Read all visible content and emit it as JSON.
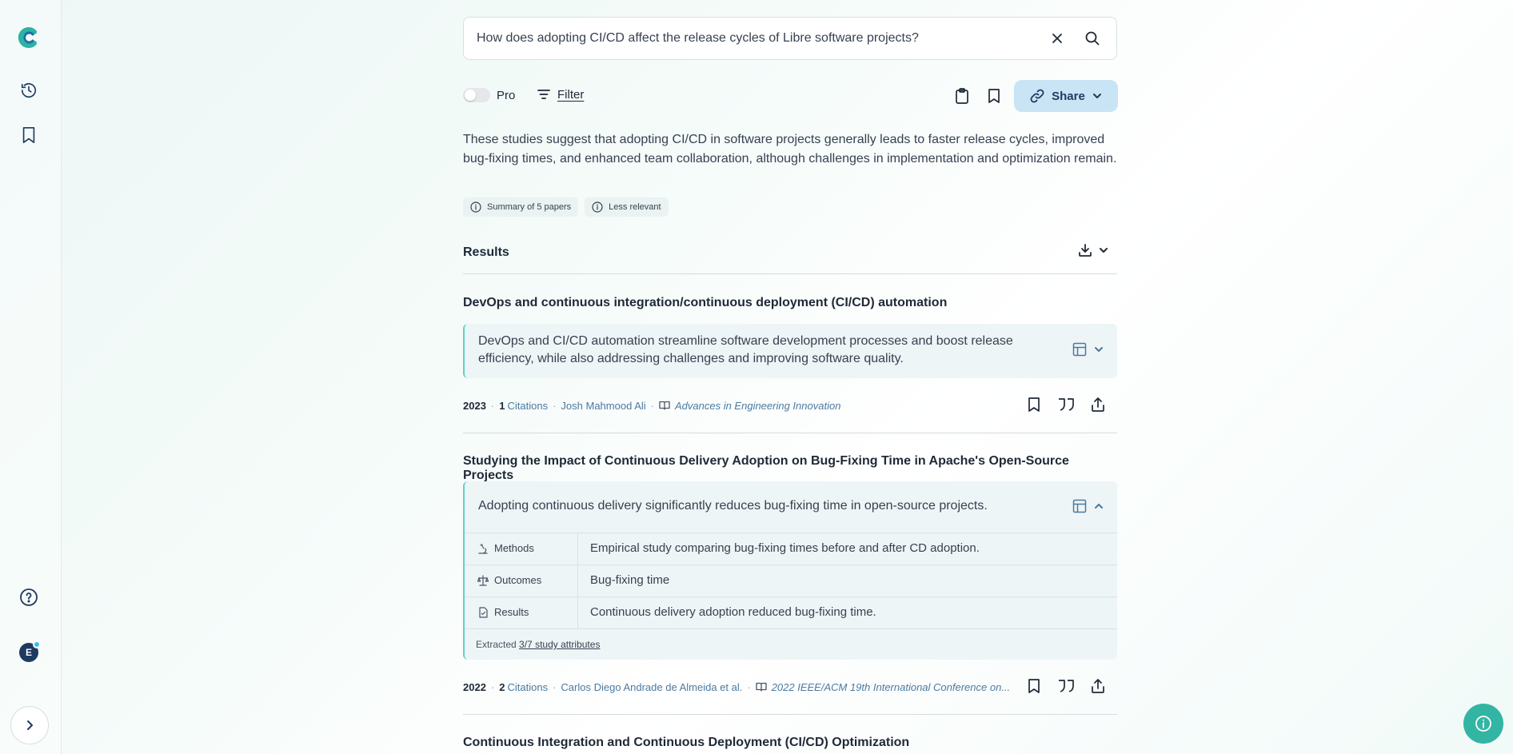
{
  "search": {
    "query": "How does adopting CI/CD affect the release cycles of Libre software projects?"
  },
  "toolbar": {
    "pro_label": "Pro",
    "filter_label": "Filter",
    "share_label": "Share"
  },
  "summary": {
    "text": "These studies suggest that adopting CI/CD in software projects generally leads to faster release cycles, improved bug-fixing times, and enhanced team collaboration, although challenges in implementation and optimization remain.",
    "chips": [
      "Summary of 5 papers",
      "Less relevant"
    ]
  },
  "results": {
    "heading": "Results",
    "papers": [
      {
        "title": "DevOps and continuous integration/continuous deployment (CI/CD) automation",
        "tldr": "DevOps and CI/CD automation streamline software development processes and boost release efficiency, while also addressing challenges and improving software quality.",
        "year": "2023",
        "citations_count": "1",
        "citations_label": "Citations",
        "authors": "Josh Mahmood Ali",
        "journal": "Advances in Engineering Innovation"
      },
      {
        "title": "Studying the Impact of Continuous Delivery Adoption on Bug-Fixing Time in Apache's Open-Source Projects",
        "tldr": "Adopting continuous delivery significantly reduces bug-fixing time in open-source projects.",
        "attributes": [
          {
            "label": "Methods",
            "value": "Empirical study comparing bug-fixing times before and after CD adoption."
          },
          {
            "label": "Outcomes",
            "value": "Bug-fixing time"
          },
          {
            "label": "Results",
            "value": "Continuous delivery adoption reduced bug-fixing time."
          }
        ],
        "extracted_prefix": "Extracted",
        "extracted_link": "3/7 study attributes",
        "year": "2022",
        "citations_count": "2",
        "citations_label": "Citations",
        "authors": "Carlos Diego Andrade de Almeida et al.",
        "journal": "2022 IEEE/ACM 19th International Conference on..."
      },
      {
        "title": "Continuous Integration and Continuous Deployment (CI/CD) Optimization"
      }
    ]
  },
  "avatar": {
    "initial": "E"
  },
  "colors": {
    "accent": "#33b5a4",
    "share_bg": "#c8e4f5",
    "tldr_border": "#5dd3c4",
    "link": "#4b7aa0"
  }
}
